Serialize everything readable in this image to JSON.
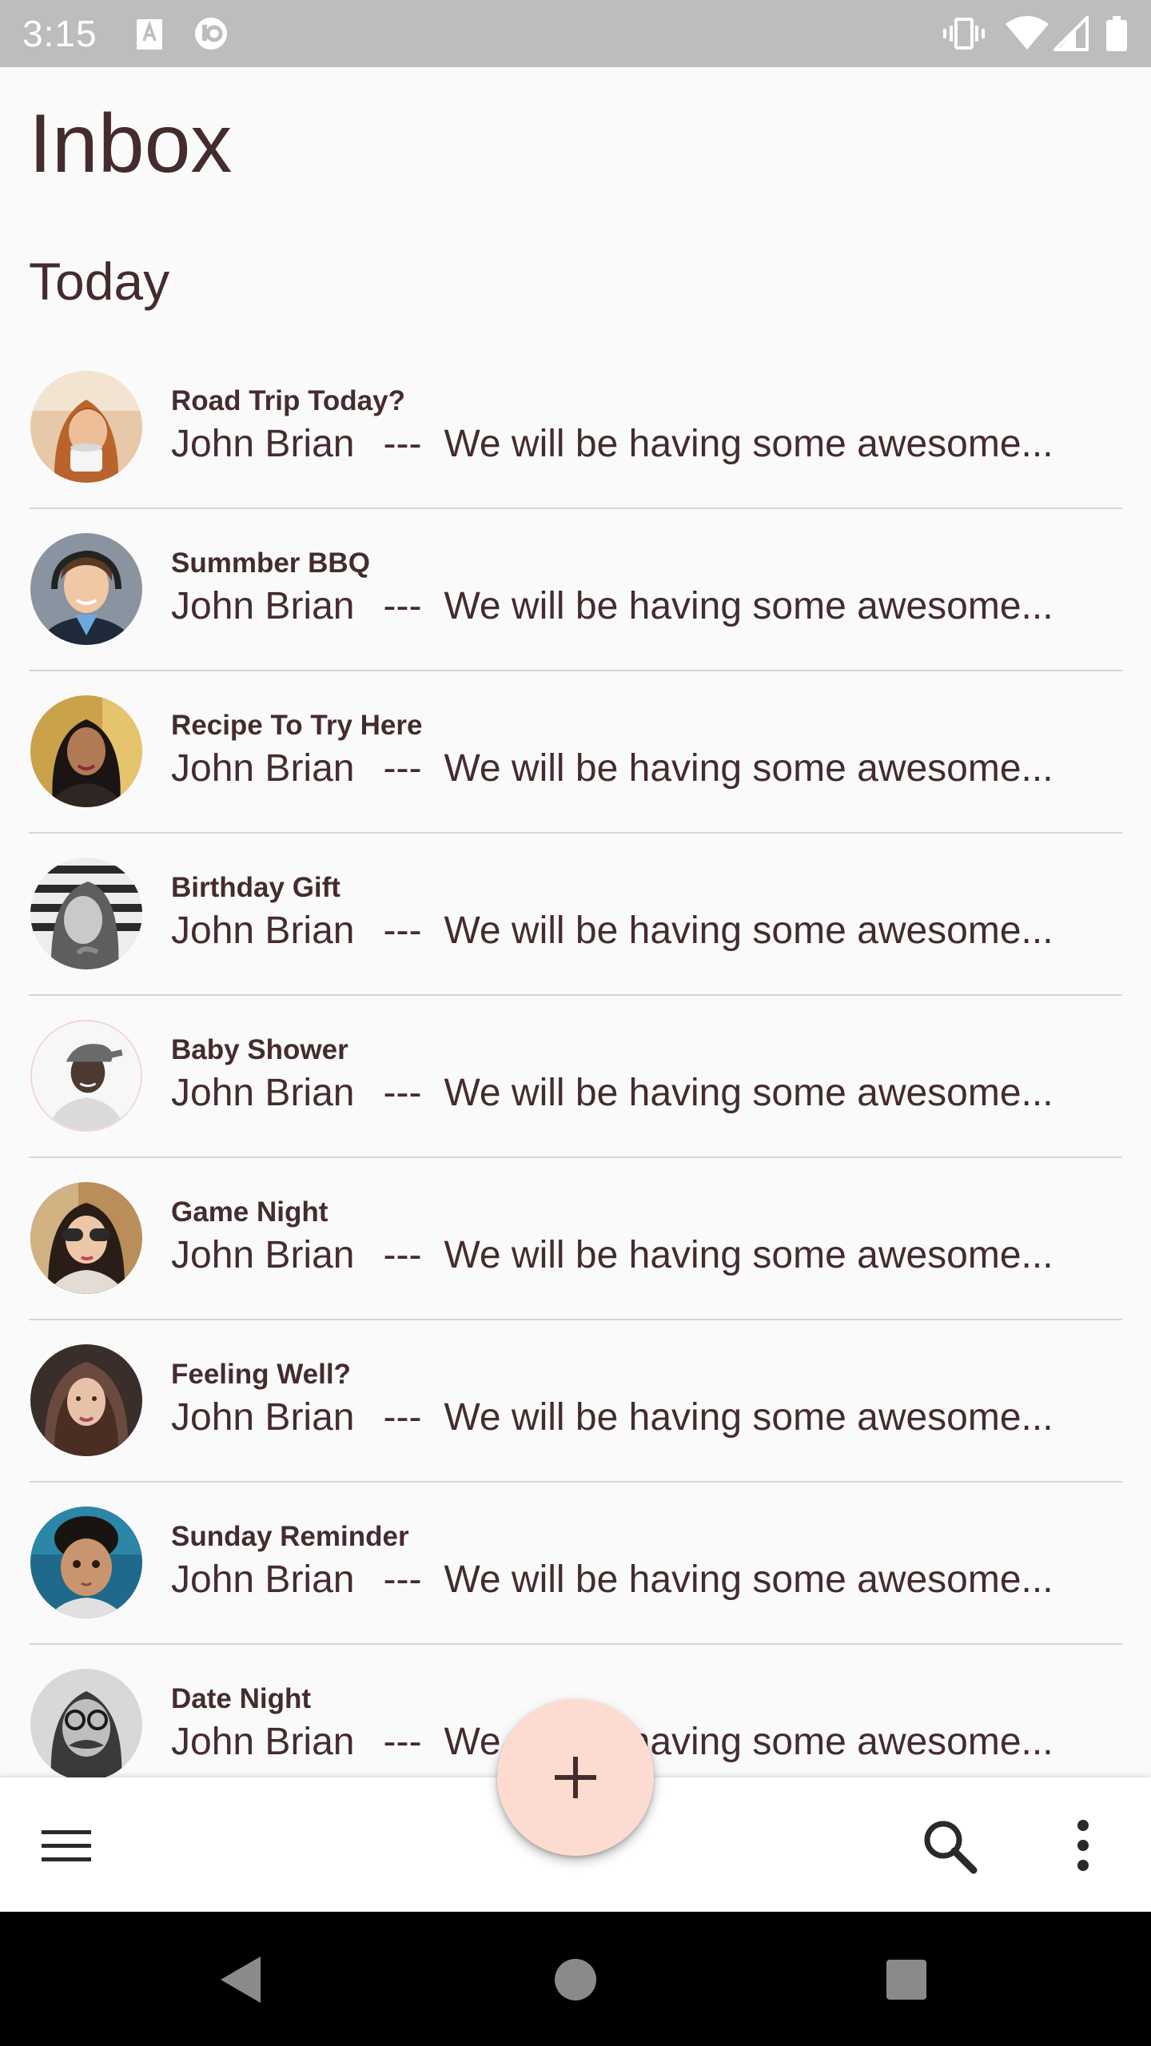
{
  "status_bar": {
    "time": "3:15",
    "icons": [
      "text-a-icon",
      "sync-circle-icon",
      "vibrate-icon",
      "wifi-icon",
      "signal-icon",
      "battery-icon"
    ]
  },
  "header": {
    "title": "Inbox"
  },
  "section": {
    "title": "Today"
  },
  "emails": [
    {
      "subject": "Road Trip Today?",
      "sender": "John Brian",
      "separator": "---",
      "preview": "We will be having some awesome..."
    },
    {
      "subject": "Summber BBQ",
      "sender": "John Brian",
      "separator": "---",
      "preview": "We will be having some awesome..."
    },
    {
      "subject": "Recipe To Try Here",
      "sender": "John Brian",
      "separator": "---",
      "preview": "We will be having some awesome..."
    },
    {
      "subject": "Birthday Gift",
      "sender": "John Brian",
      "separator": "---",
      "preview": "We will be having some awesome..."
    },
    {
      "subject": "Baby Shower",
      "sender": "John Brian",
      "separator": "---",
      "preview": "We will be having some awesome..."
    },
    {
      "subject": "Game Night",
      "sender": "John Brian",
      "separator": "---",
      "preview": "We will be having some awesome..."
    },
    {
      "subject": "Feeling Well?",
      "sender": "John Brian",
      "separator": "---",
      "preview": "We will be having some awesome..."
    },
    {
      "subject": "Sunday Reminder",
      "sender": "John Brian",
      "separator": "---",
      "preview": "We will be having some awesome..."
    },
    {
      "subject": "Date Night",
      "sender": "John Brian",
      "separator": "---",
      "preview": "We will be having some awesome..."
    }
  ],
  "bottom_bar": {
    "icons": [
      "menu-icon",
      "add-icon",
      "search-icon",
      "more-vert-icon"
    ]
  },
  "nav_bar": {
    "icons": [
      "back-icon",
      "home-icon",
      "recents-icon"
    ]
  },
  "colors": {
    "text": "#442C2E",
    "background": "#FAFAFA",
    "fab": "#FEDBD0",
    "status_bar": "#BDBDBD",
    "divider": "#D9D5D5"
  }
}
